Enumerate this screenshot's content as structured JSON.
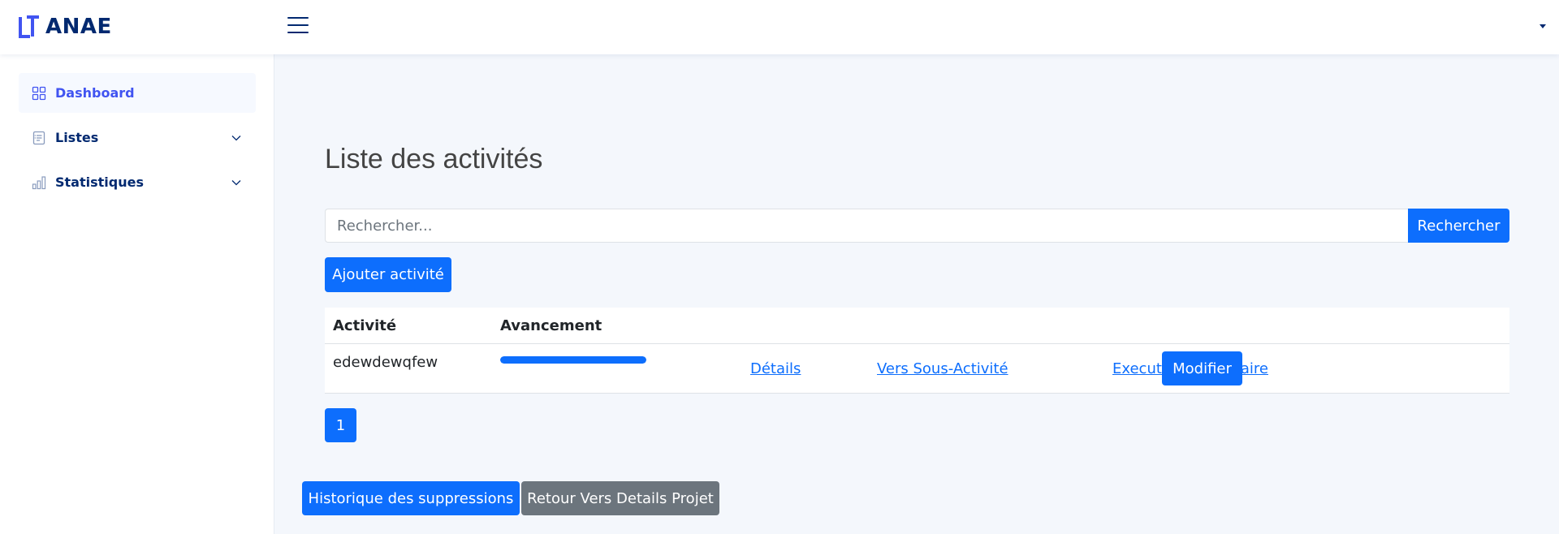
{
  "header": {
    "brand": "ANAE",
    "menu_icon": "hamburger-icon",
    "profile_icon": "caret-down-icon",
    "brand_color": "#4154f1"
  },
  "sidebar": {
    "items": [
      {
        "label": "Dashboard",
        "icon": "grid-icon",
        "active": true
      },
      {
        "label": "Listes",
        "icon": "list-document-icon",
        "expandable": true
      },
      {
        "label": "Statistiques",
        "icon": "bar-chart-icon",
        "expandable": true
      }
    ]
  },
  "main": {
    "title": "Liste des activités",
    "search": {
      "placeholder": "Rechercher...",
      "value": "",
      "button": "Rechercher"
    },
    "add_button": "Ajouter activité",
    "table": {
      "headers": [
        "Activité",
        "Avancement"
      ],
      "rows": [
        {
          "activite": "edewdewqfew",
          "progress": 1.0,
          "links": [
            "Détails",
            "Vers Sous-Activité",
            "Execution budgetaire"
          ],
          "action": "Modifier"
        }
      ]
    },
    "pagination": {
      "current": "1"
    },
    "footer_buttons": {
      "history": "Historique des suppressions",
      "back": "Retour Vers Details Projet"
    }
  },
  "colors": {
    "primary": "#0d6efd",
    "secondary": "#6c757d",
    "nav_text": "#012970",
    "page_bg": "#f4f7fc"
  }
}
